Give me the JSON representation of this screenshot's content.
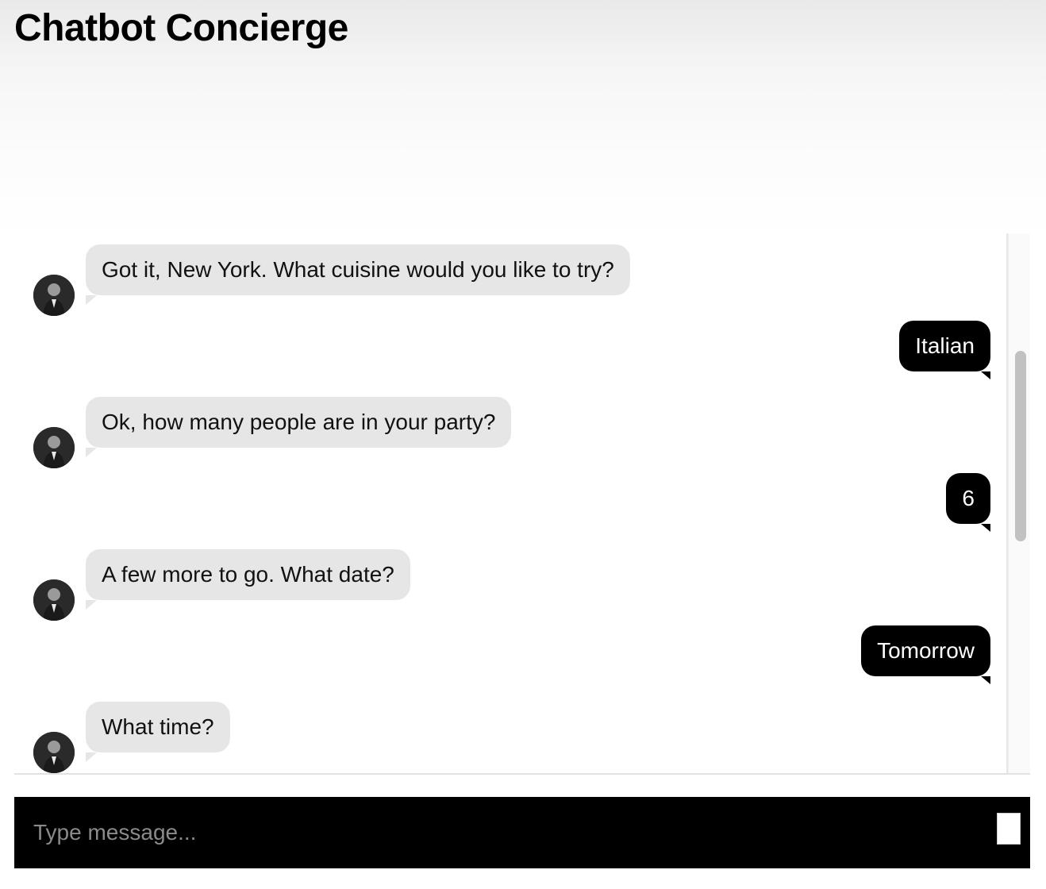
{
  "header": {
    "title": "Chatbot Concierge"
  },
  "messages": [
    {
      "sender": "bot",
      "text": "Got it, New York. What cuisine would you like to try?"
    },
    {
      "sender": "user",
      "text": "Italian"
    },
    {
      "sender": "bot",
      "text": "Ok, how many people are in your party?"
    },
    {
      "sender": "user",
      "text": "6"
    },
    {
      "sender": "bot",
      "text": "A few more to go. What date?"
    },
    {
      "sender": "user",
      "text": "Tomorrow"
    },
    {
      "sender": "bot",
      "text": "What time?"
    }
  ],
  "composer": {
    "placeholder": "Type message...",
    "send_icon": "send-icon"
  },
  "colors": {
    "bot_bubble": "#e6e6e6",
    "user_bubble": "#000000",
    "input_bar": "#000000"
  }
}
